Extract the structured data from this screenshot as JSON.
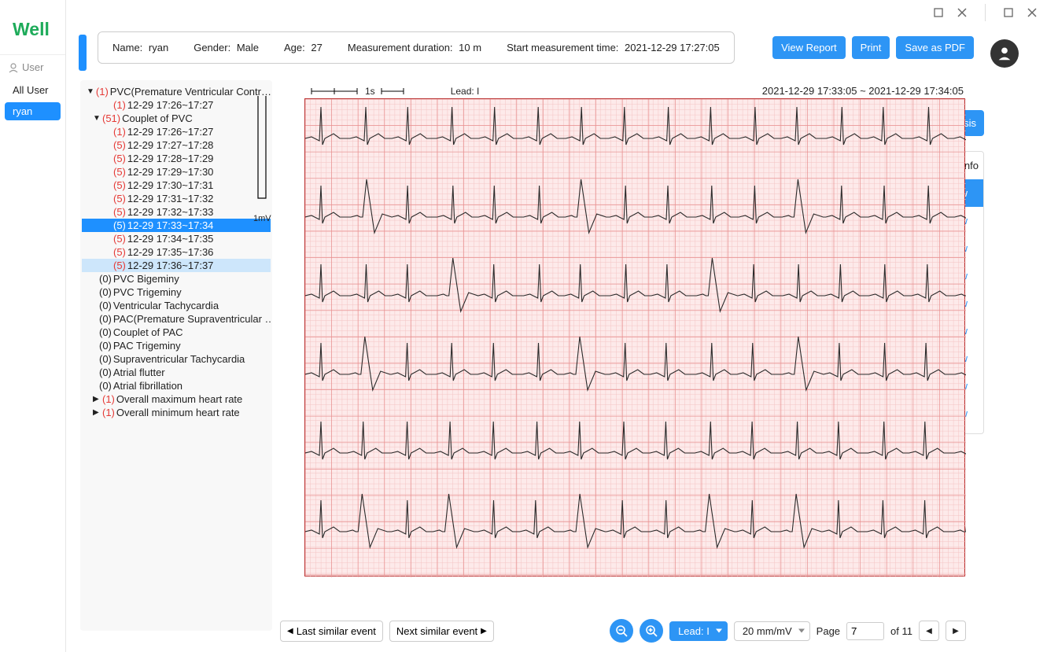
{
  "window": {
    "minimize": "—",
    "maximize": "▢",
    "close": "✕"
  },
  "brand": "Well",
  "leftPanel": {
    "header": "User",
    "allUser": "All User",
    "selectedUser": "ryan"
  },
  "patient": {
    "name_label": "Name:",
    "name": "ryan",
    "gender_label": "Gender:",
    "gender": "Male",
    "age_label": "Age:",
    "age": "27",
    "dur_label": "Measurement duration:",
    "dur": "10 m",
    "start_label": "Start measurement time:",
    "start": "2021-12-29 17:27:05"
  },
  "actions": {
    "viewReport": "View Report",
    "print": "Print",
    "savePdf": "Save as PDF",
    "analysis": "n analysis"
  },
  "devicePanel": {
    "header": "vice Info",
    "links": [
      "View",
      "View",
      "View",
      "View",
      "View",
      "View",
      "View",
      "View",
      "View"
    ]
  },
  "tree": {
    "pvc": {
      "count": "(1)",
      "label": "PVC(Premature Ventricular Contr…",
      "child": {
        "count": "(1)",
        "label": "12-29 17:26~17:27"
      }
    },
    "couplet": {
      "count": "(51)",
      "label": "Couplet of PVC",
      "children": [
        {
          "count": "(1)",
          "label": "12-29 17:26~17:27"
        },
        {
          "count": "(5)",
          "label": "12-29 17:27~17:28"
        },
        {
          "count": "(5)",
          "label": "12-29 17:28~17:29"
        },
        {
          "count": "(5)",
          "label": "12-29 17:29~17:30"
        },
        {
          "count": "(5)",
          "label": "12-29 17:30~17:31"
        },
        {
          "count": "(5)",
          "label": "12-29 17:31~17:32"
        },
        {
          "count": "(5)",
          "label": "12-29 17:32~17:33"
        },
        {
          "count": "(5)",
          "label": "12-29 17:33~17:34"
        },
        {
          "count": "(5)",
          "label": "12-29 17:34~17:35"
        },
        {
          "count": "(5)",
          "label": "12-29 17:35~17:36"
        },
        {
          "count": "(5)",
          "label": "12-29 17:36~17:37"
        }
      ],
      "selectedIndex": 7,
      "hoveredIndex": 10
    },
    "others": [
      {
        "count": "(0)",
        "label": "PVC Bigeminy"
      },
      {
        "count": "(0)",
        "label": "PVC Trigeminy"
      },
      {
        "count": "(0)",
        "label": "Ventricular Tachycardia"
      },
      {
        "count": "(0)",
        "label": "PAC(Premature Supraventricular …"
      },
      {
        "count": "(0)",
        "label": "Couplet of PAC"
      },
      {
        "count": "(0)",
        "label": "PAC Trigeminy"
      },
      {
        "count": "(0)",
        "label": "Supraventricular Tachycardia"
      },
      {
        "count": "(0)",
        "label": "Atrial flutter"
      },
      {
        "count": "(0)",
        "label": "Atrial fibrillation"
      }
    ],
    "hrMax": {
      "count": "(1)",
      "label": "Overall maximum heart rate"
    },
    "hrMin": {
      "count": "(1)",
      "label": "Overall minimum heart rate"
    }
  },
  "ecg": {
    "scale_time": "1s",
    "lead_label": "Lead: I",
    "timeRange": "2021-12-29 17:33:05 ~ 2021-12-29 17:34:05",
    "scale_mv": "1mV"
  },
  "bottom": {
    "prevSimilar": "Last similar event",
    "nextSimilar": "Next similar event",
    "leadSelect": "Lead: I",
    "gainSelect": "20 mm/mV",
    "page_label": "Page",
    "page_val": "7",
    "page_total": "of 11"
  }
}
